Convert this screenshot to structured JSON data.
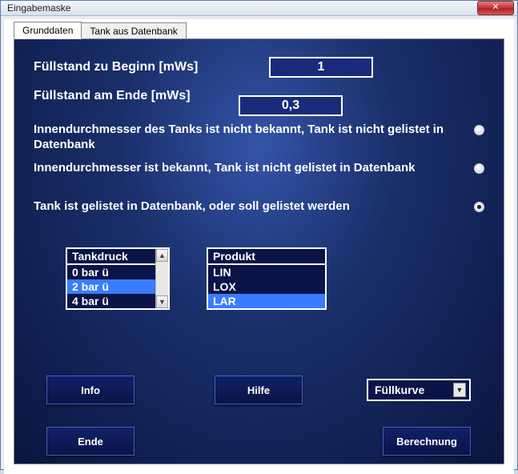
{
  "window": {
    "title": "Eingabemaske"
  },
  "tabs": {
    "active": "Grunddaten",
    "other": "Tank aus Datenbank"
  },
  "fields": {
    "begin_label": "Füllstand zu Beginn [mWs]",
    "begin_value": "1",
    "end_label": "Füllstand am Ende [mWs]",
    "end_value": "0,3"
  },
  "radios": {
    "opt1": "Innendurchmesser des Tanks ist nicht bekannt, Tank ist nicht gelistet in Datenbank",
    "opt2": "Innendurchmesser ist bekannt, Tank ist nicht gelistet in Datenbank",
    "opt3": "Tank ist gelistet in Datenbank, oder soll gelistet werden",
    "selected": 3
  },
  "list_pressure": {
    "header": "Tankdruck",
    "items": [
      "0 bar ü",
      "2 bar ü",
      "4 bar ü"
    ],
    "selected": "2 bar ü"
  },
  "list_product": {
    "header": "Produkt",
    "items": [
      "LIN",
      "LOX",
      "LAR"
    ],
    "selected": "LAR"
  },
  "buttons": {
    "info": "Info",
    "hilfe": "Hilfe",
    "ende": "Ende",
    "berechnung": "Berechnung"
  },
  "combo": {
    "label": "Füllkurve"
  }
}
